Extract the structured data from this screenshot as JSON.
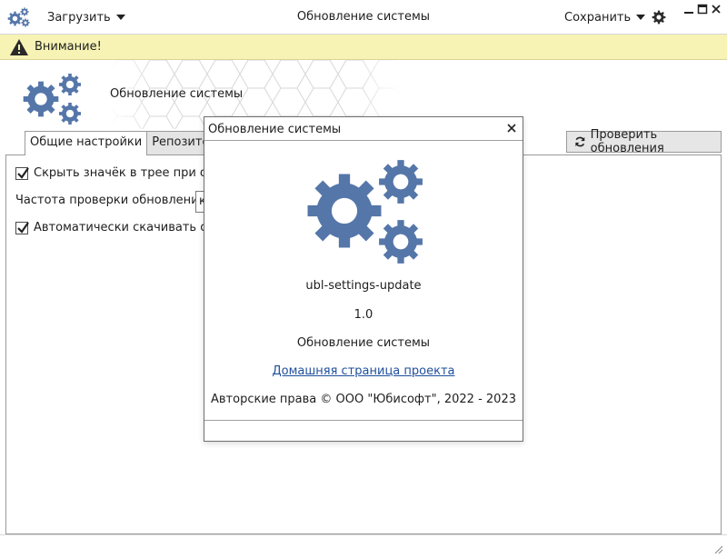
{
  "titlebar": {
    "load_menu": "Загрузить",
    "title": "Обновление системы",
    "save_menu": "Сохранить"
  },
  "warning": {
    "text": "Внимание!"
  },
  "header": {
    "title": "Обновление системы"
  },
  "tabs": [
    {
      "label": "Общие настройки",
      "active": true
    },
    {
      "label": "Репозитории",
      "active": false
    }
  ],
  "check_updates_button": "Проверить обновления",
  "settings": {
    "hide_tray_icon": {
      "label": "Скрыть значёк в трее при отсут",
      "checked": true
    },
    "check_frequency": {
      "label": "Частота проверки обновлений",
      "value": "к"
    },
    "auto_download": {
      "label": "Автоматически скачивать обнов",
      "checked": true
    }
  },
  "about_dialog": {
    "title": "Обновление системы",
    "app_name": "ubl-settings-update",
    "version": "1.0",
    "description": "Обновление системы",
    "homepage_link": "Домашняя страница проекта",
    "copyright": "Авторские права © ООО \"Юбисофт\", 2022 - 2023"
  },
  "colors": {
    "gear_blue": "#5576a9",
    "warning_bg": "#f6f3b4",
    "link": "#1e4f9c"
  },
  "icons": {
    "app": "gears-icon",
    "settings": "gear-icon",
    "warning": "warning-icon",
    "refresh": "refresh-icon",
    "close": "close-icon"
  }
}
